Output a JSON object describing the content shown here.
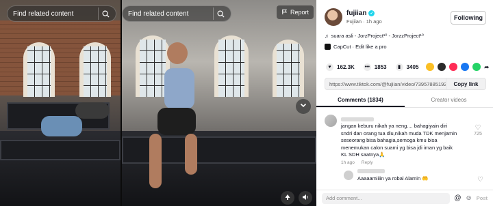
{
  "video": {
    "left_search_placeholder": "Find related content",
    "right_search_placeholder": "Find related content",
    "report_label": "Report"
  },
  "author": {
    "name": "fujiian",
    "subtitle": "Fujiian · 1h ago",
    "follow_label": "Following"
  },
  "music": {
    "text": "suara asli - JorzProject¹⁰ - JorzzProject¹⁰"
  },
  "capcut": {
    "text": "CapCut · Edit like a pro"
  },
  "stats": {
    "likes": "162.3K",
    "comments": "1853",
    "saves": "3405"
  },
  "share_colors": [
    "#fbbf24",
    "#2b2b2b",
    "#ff2c55",
    "#1877f2",
    "#25d366"
  ],
  "link": {
    "url": "https://www.tiktok.com/@fujiian/video/73957885192...",
    "copy_label": "Copy link"
  },
  "tabs": [
    {
      "label": "Comments (1834)"
    },
    {
      "label": "Creator videos"
    }
  ],
  "comment": {
    "text": "jangan keburu nikah ya neng.... bahagiyain diri sndri dan orang tua dlu,nikah muda TDK menjamin seseorang bisa bahagia,semoga kmu bisa menemukan calon suami yg bisa jdi iman yg baik KL SDH saatnya🙏",
    "time": "1h ago",
    "reply_label": "Reply",
    "likes": "725"
  },
  "reply": {
    "text": "Aaaaamiiiin ya robal Alamin 🤲"
  },
  "add_comment": {
    "placeholder": "Add comment...",
    "post_label": "Post"
  }
}
